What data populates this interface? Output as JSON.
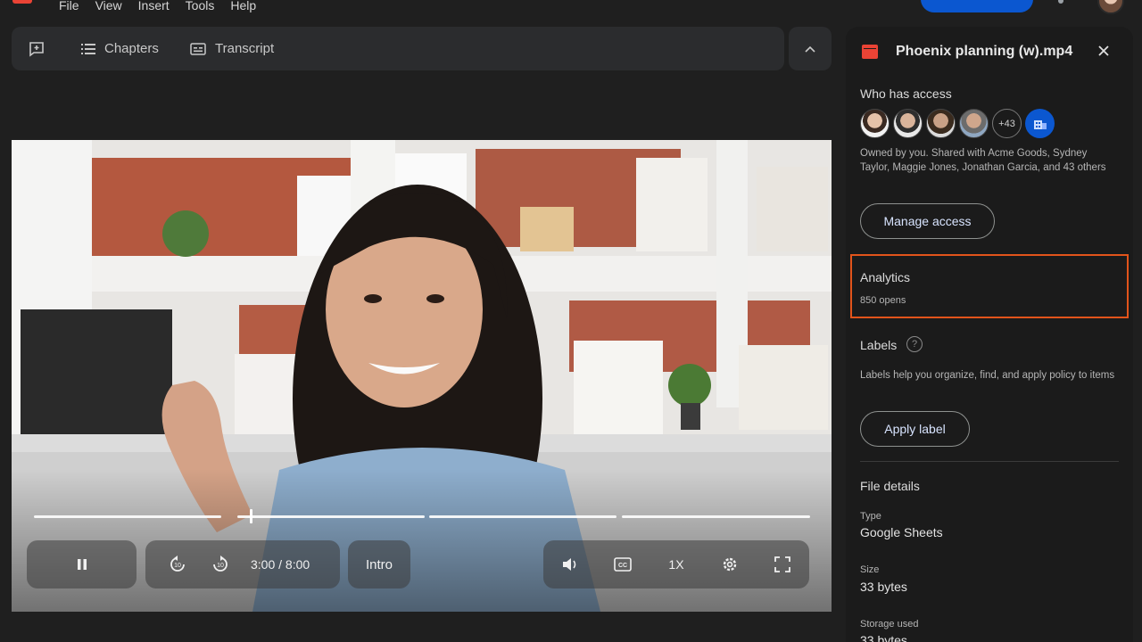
{
  "menu": [
    "File",
    "View",
    "Insert",
    "Tools",
    "Help"
  ],
  "video_toolbar": {
    "chapters_label": "Chapters",
    "transcript_label": "Transcript"
  },
  "player": {
    "time": "3:00 / 8:00",
    "chapter": "Intro",
    "speed": "1X",
    "progress_fraction": 0.375
  },
  "panel": {
    "file_name": "Phoenix planning (w).mp4",
    "who_has_access": "Who has access",
    "more_people": "+43",
    "owner_text": "Owned by you. Shared with Acme Goods, Sydney Taylor, Maggie Jones, Jonathan Garcia, and 43 others",
    "manage_access": "Manage access",
    "analytics_title": "Analytics",
    "analytics_value": "850 opens",
    "labels_title": "Labels",
    "labels_desc": "Labels help you organize, find, and apply policy to items",
    "apply_label": "Apply label",
    "file_details": "File details",
    "type_label": "Type",
    "type_value": "Google Sheets",
    "size_label": "Size",
    "size_value": "33 bytes",
    "storage_label": "Storage used",
    "storage_value": "33 bytes"
  },
  "colors": {
    "accent_blue": "#0b57d0",
    "highlight_orange": "#e2541b",
    "file_red": "#ea4335"
  }
}
